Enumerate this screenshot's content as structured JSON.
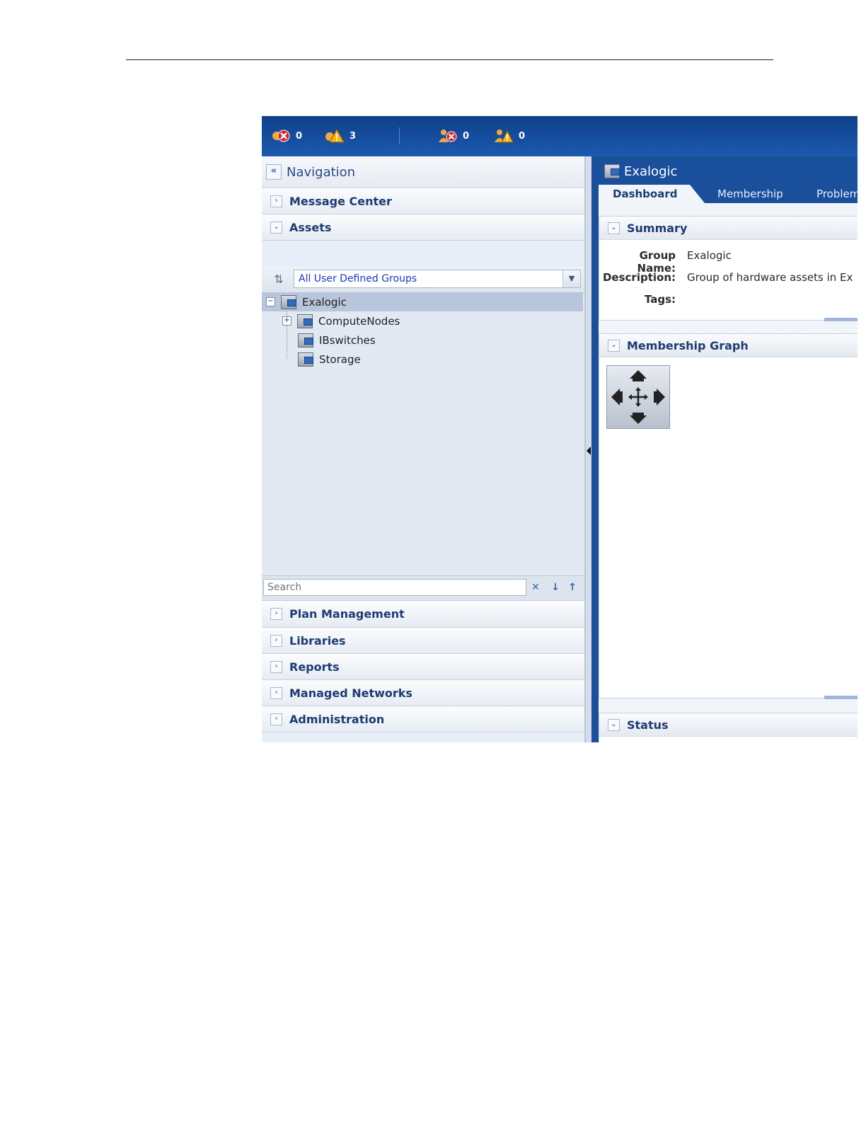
{
  "alerts": [
    {
      "icon": "critical-incident-icon",
      "count": "0",
      "color": "#d9202a"
    },
    {
      "icon": "warning-incident-icon",
      "count": "3",
      "color": "#f4b41a"
    },
    {
      "icon": "critical-user-incident-icon",
      "count": "0",
      "color": "#d9202a"
    },
    {
      "icon": "warning-user-incident-icon",
      "count": "0",
      "color": "#f4b41a"
    }
  ],
  "navigation": {
    "title": "Navigation",
    "collapse_glyph": "«",
    "message_center": "Message Center",
    "assets": "Assets",
    "group_selector": "All User Defined Groups",
    "tree": {
      "root": "Exalogic",
      "children": [
        "ComputeNodes",
        "IBswitches",
        "Storage"
      ]
    },
    "search_placeholder": "Search",
    "sections": [
      "Plan Management",
      "Libraries",
      "Reports",
      "Managed Networks",
      "Administration"
    ]
  },
  "detail": {
    "title": "Exalogic",
    "tabs": [
      "Dashboard",
      "Membership",
      "Problem"
    ],
    "summary": {
      "heading": "Summary",
      "group_name_label": "Group Name:",
      "group_name": "Exalogic",
      "description_label": "Description:",
      "description": "Group of hardware assets in Ex",
      "tags_label": "Tags:"
    },
    "membership_graph": "Membership Graph",
    "status": "Status"
  },
  "colors": {
    "header_blue": "#1a4f9c",
    "link_blue": "#1a36c7",
    "heading_navy": "#1d3b73"
  }
}
